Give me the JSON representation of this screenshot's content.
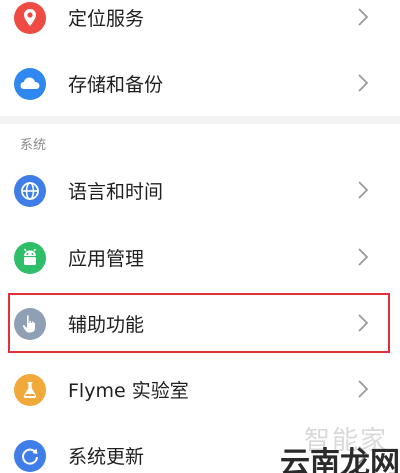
{
  "settings": {
    "items_top": [
      {
        "label": "定位服务",
        "icon": "location-pin-icon",
        "icon_color": "#ef4b45"
      },
      {
        "label": "存储和备份",
        "icon": "cloud-icon",
        "icon_color": "#2f88f0"
      }
    ],
    "section_label": "系统",
    "items_system": [
      {
        "label": "语言和时间",
        "icon": "globe-icon",
        "icon_color": "#3f7ee8"
      },
      {
        "label": "应用管理",
        "icon": "android-icon",
        "icon_color": "#2fbf6a"
      },
      {
        "label": "辅助功能",
        "icon": "hand-pointer-icon",
        "icon_color": "#8fa0b5"
      },
      {
        "label": "Flyme 实验室",
        "icon": "flask-icon",
        "icon_color": "#f2a93b"
      },
      {
        "label": "系统更新",
        "icon": "refresh-icon",
        "icon_color": "#3f7ee8"
      }
    ]
  },
  "highlight": {
    "color": "#e0303a"
  },
  "watermark": {
    "top_text": "智能家",
    "bottom_text": "云南龙网"
  }
}
